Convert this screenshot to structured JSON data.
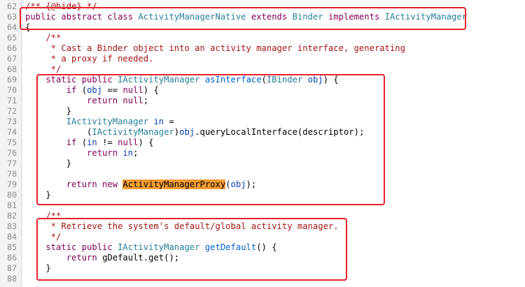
{
  "lines": [
    {
      "num": "62",
      "tokens": [
        {
          "t": "/** {@hide} */",
          "c": "cm"
        }
      ]
    },
    {
      "num": "63",
      "tokens": [
        {
          "t": "public abstract class ",
          "c": "kw"
        },
        {
          "t": "ActivityManagerNative",
          "c": "type"
        },
        {
          "t": " extends ",
          "c": "kw"
        },
        {
          "t": "Binder",
          "c": "type"
        },
        {
          "t": " implements ",
          "c": "kw"
        },
        {
          "t": "IActivityManager",
          "c": "type"
        }
      ]
    },
    {
      "num": "64",
      "tokens": [
        {
          "t": "{",
          "c": ""
        }
      ]
    },
    {
      "num": "65",
      "tokens": [
        {
          "t": "    /**",
          "c": "cm"
        }
      ]
    },
    {
      "num": "66",
      "tokens": [
        {
          "t": "     * Cast a Binder object into an activity manager interface, generating",
          "c": "cm"
        }
      ]
    },
    {
      "num": "67",
      "tokens": [
        {
          "t": "     * a proxy if needed.",
          "c": "cm"
        }
      ]
    },
    {
      "num": "68",
      "tokens": [
        {
          "t": "     */",
          "c": "cm"
        }
      ]
    },
    {
      "num": "69",
      "tokens": [
        {
          "t": "    static public ",
          "c": "kw"
        },
        {
          "t": "IActivityManager",
          "c": "type"
        },
        {
          "t": " ",
          "c": ""
        },
        {
          "t": "asInterface",
          "c": "fn"
        },
        {
          "t": "(",
          "c": ""
        },
        {
          "t": "IBinder",
          "c": "type"
        },
        {
          "t": " ",
          "c": ""
        },
        {
          "t": "obj",
          "c": "var"
        },
        {
          "t": ") {",
          "c": ""
        }
      ]
    },
    {
      "num": "70",
      "tokens": [
        {
          "t": "        if",
          "c": "kw"
        },
        {
          "t": " (",
          "c": ""
        },
        {
          "t": "obj",
          "c": "var"
        },
        {
          "t": " == ",
          "c": ""
        },
        {
          "t": "null",
          "c": "kw"
        },
        {
          "t": ") {",
          "c": ""
        }
      ]
    },
    {
      "num": "71",
      "tokens": [
        {
          "t": "            return ",
          "c": "kw"
        },
        {
          "t": "null",
          "c": "kw"
        },
        {
          "t": ";",
          "c": ""
        }
      ]
    },
    {
      "num": "72",
      "tokens": [
        {
          "t": "        }",
          "c": ""
        }
      ]
    },
    {
      "num": "73",
      "tokens": [
        {
          "t": "        IActivityManager",
          "c": "type"
        },
        {
          "t": " ",
          "c": ""
        },
        {
          "t": "in",
          "c": "var"
        },
        {
          "t": " =",
          "c": ""
        }
      ]
    },
    {
      "num": "74",
      "tokens": [
        {
          "t": "            (",
          "c": ""
        },
        {
          "t": "IActivityManager",
          "c": "type"
        },
        {
          "t": ")",
          "c": ""
        },
        {
          "t": "obj",
          "c": "var"
        },
        {
          "t": ".queryLocalInterface(descriptor);",
          "c": ""
        }
      ]
    },
    {
      "num": "75",
      "tokens": [
        {
          "t": "        if",
          "c": "kw"
        },
        {
          "t": " (",
          "c": ""
        },
        {
          "t": "in",
          "c": "var"
        },
        {
          "t": " != ",
          "c": ""
        },
        {
          "t": "null",
          "c": "kw"
        },
        {
          "t": ") {",
          "c": ""
        }
      ]
    },
    {
      "num": "76",
      "tokens": [
        {
          "t": "            return ",
          "c": "kw"
        },
        {
          "t": "in",
          "c": "var"
        },
        {
          "t": ";",
          "c": ""
        }
      ]
    },
    {
      "num": "77",
      "tokens": [
        {
          "t": "        }",
          "c": ""
        }
      ]
    },
    {
      "num": "78",
      "tokens": [
        {
          "t": "",
          "c": ""
        }
      ]
    },
    {
      "num": "79",
      "tokens": [
        {
          "t": "        return new ",
          "c": "kw"
        },
        {
          "t": "ActivityManagerProxy",
          "c": "hl"
        },
        {
          "t": "(",
          "c": ""
        },
        {
          "t": "obj",
          "c": "var"
        },
        {
          "t": ");",
          "c": ""
        }
      ]
    },
    {
      "num": "80",
      "tokens": [
        {
          "t": "    }",
          "c": ""
        }
      ]
    },
    {
      "num": "81",
      "tokens": [
        {
          "t": "",
          "c": ""
        }
      ]
    },
    {
      "num": "82",
      "tokens": [
        {
          "t": "    /**",
          "c": "cm"
        }
      ]
    },
    {
      "num": "83",
      "tokens": [
        {
          "t": "     * Retrieve the system's default/global activity manager.",
          "c": "cm"
        }
      ]
    },
    {
      "num": "84",
      "tokens": [
        {
          "t": "     */",
          "c": "cm"
        }
      ]
    },
    {
      "num": "85",
      "tokens": [
        {
          "t": "    static public ",
          "c": "kw"
        },
        {
          "t": "IActivityManager",
          "c": "type"
        },
        {
          "t": " ",
          "c": ""
        },
        {
          "t": "getDefault",
          "c": "fn"
        },
        {
          "t": "() {",
          "c": ""
        }
      ]
    },
    {
      "num": "86",
      "tokens": [
        {
          "t": "        return ",
          "c": "kw"
        },
        {
          "t": "gDefault.get();",
          "c": ""
        }
      ]
    },
    {
      "num": "87",
      "tokens": [
        {
          "t": "    }",
          "c": ""
        }
      ]
    },
    {
      "num": "88",
      "tokens": [
        {
          "t": "",
          "c": ""
        }
      ]
    }
  ],
  "highlight_color": "#f39c32",
  "annotation_color": "#e8202a"
}
